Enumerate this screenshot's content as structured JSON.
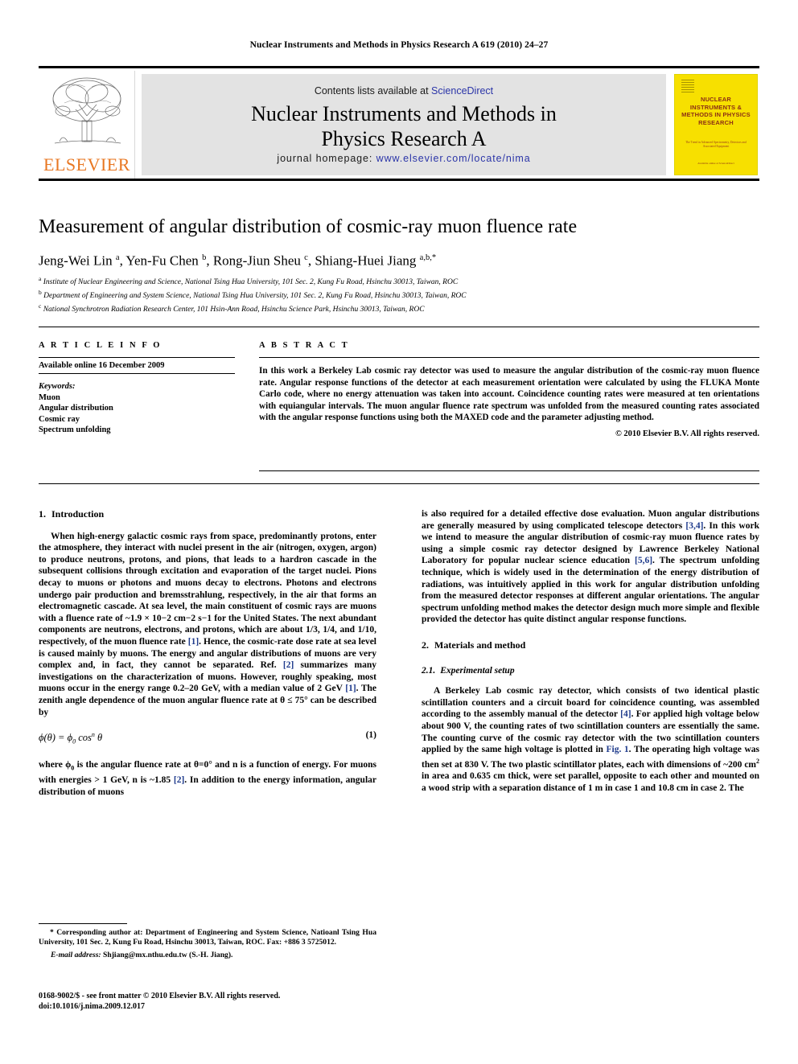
{
  "running_head": "Nuclear Instruments and Methods in Physics Research A 619 (2010) 24–27",
  "masthead": {
    "publisher_wordmark": "ELSEVIER",
    "contents_prefix": "Contents lists available at ",
    "contents_link": "ScienceDirect",
    "journal_title_line1": "Nuclear Instruments and Methods in",
    "journal_title_line2": "Physics Research A",
    "homepage_prefix": "journal homepage: ",
    "homepage_url": "www.elsevier.com/locate/nima",
    "cover": {
      "title": "NUCLEAR INSTRUMENTS & METHODS IN PHYSICS RESEARCH",
      "subtitle": "The Trend in Advanced Spectrometry, Detectors and Associated Equipment",
      "footer": "Available online at ScienceDirect"
    },
    "accent_orange": "#E87722",
    "link_blue": "#2b35a8",
    "cover_yellow": "#f7e000"
  },
  "article": {
    "title": "Measurement of angular distribution of cosmic-ray muon fluence rate",
    "authors": "Jeng-Wei Lin a, Yen-Fu Chen b, Rong-Jiun Sheu c, Shiang-Huei Jiang a,b,*",
    "affiliations": [
      "a Institute of Nuclear Engineering and Science, National Tsing Hua University, 101 Sec. 2, Kung Fu Road, Hsinchu 30013, Taiwan, ROC",
      "b Department of Engineering and System Science, National Tsing Hua University, 101 Sec. 2, Kung Fu Road, Hsinchu 30013, Taiwan, ROC",
      "c National Synchrotron Radiation Research Center, 101 Hsin-Ann Road, Hsinchu Science Park, Hsinchu 30013, Taiwan, ROC"
    ]
  },
  "article_info": {
    "heading": "A R T I C L E   I N F O",
    "available_online": "Available online 16 December 2009",
    "keywords_label": "Keywords:",
    "keywords": [
      "Muon",
      "Angular distribution",
      "Cosmic ray",
      "Spectrum unfolding"
    ]
  },
  "abstract": {
    "heading": "A B S T R A C T",
    "text": "In this work a Berkeley Lab cosmic ray detector was used to measure the angular distribution of the cosmic-ray muon fluence rate. Angular response functions of the detector at each measurement orientation were calculated by using the FLUKA Monte Carlo code, where no energy attenuation was taken into account. Coincidence counting rates were measured at ten orientations with equiangular intervals. The muon angular fluence rate spectrum was unfolded from the measured counting rates associated with the angular response functions using both the MAXED code and the parameter adjusting method.",
    "copyright": "© 2010 Elsevier B.V. All rights reserved."
  },
  "body": {
    "section1_num": "1.",
    "section1_title": "Introduction",
    "section2_num": "2.",
    "section2_title": "Materials and method",
    "section21_num": "2.1.",
    "section21_title": "Experimental setup",
    "left_p1_a": "When high-energy galactic cosmic rays from space, predominantly protons, enter the atmosphere, they interact with nuclei present in the air (nitrogen, oxygen, argon) to produce neutrons, protons, and pions, that leads to a hardron cascade in the subsequent collisions through excitation and evaporation of the target nuclei. Pions decay to muons or photons and muons decay to electrons. Photons and electrons undergo pair production and bremsstrahlung, respectively, in the air that forms an electromagnetic cascade. At sea level, the main constituent of cosmic rays are muons with a fluence rate of ",
    "left_p1_rate": "~1.9 × 10−2 cm−2 s−1",
    "left_p1_b": " for the United States. The next abundant components are neutrons, electrons, and protons, which are about 1/3, 1/4, and 1/10, respectively, of the muon fluence rate ",
    "cite1": "[1]",
    "left_p1_c": ". Hence, the cosmic-rate dose rate at sea level is caused mainly by muons. The energy and angular distributions of muons are very complex and, in fact, they cannot be separated. Ref. ",
    "cite2": "[2]",
    "left_p1_d": " summarizes many investigations on the characterization of muons. However, roughly speaking, most muons occur in the energy range 0.2–20 GeV, with a median value of 2 GeV ",
    "cite1b": "[1]",
    "left_p1_e": ". The zenith angle dependence of the muon angular fluence rate at θ ≤ 75° can be described by",
    "equation": "ϕ(θ) = ϕ0 cosn θ",
    "equation_number": "(1)",
    "left_p2_a": "where ϕ0 is the angular fluence rate at θ=0° and n is a function of energy. For muons with energies > 1 GeV, n is ~1.85 ",
    "cite2b": "[2]",
    "left_p2_b": ". In addition to the energy information, angular distribution of muons",
    "right_p1_a": "is also required for a detailed effective dose evaluation. Muon angular distributions are generally measured by using complicated telescope detectors ",
    "cite34": "[3,4]",
    "right_p1_b": ". In this work we intend to measure the angular distribution of cosmic-ray muon fluence rates by using a simple cosmic ray detector designed by Lawrence Berkeley National Laboratory for popular nuclear science education ",
    "cite56": "[5,6]",
    "right_p1_c": ". The spectrum unfolding technique, which is widely used in the determination of the energy distribution of radiations, was intuitively applied in this work for angular distribution unfolding from the measured detector responses at different angular orientations. The angular spectrum unfolding method makes the detector design much more simple and flexible provided the detector has quite distinct angular response functions.",
    "right_p2_a": "A Berkeley Lab cosmic ray detector, which consists of two identical plastic scintillation counters and a circuit board for coincidence counting, was assembled according to the assembly manual of the detector ",
    "cite4": "[4]",
    "right_p2_b": ". For applied high voltage below about 900 V, the counting rates of two scintillation counters are essentially the same. The counting curve of the cosmic ray detector with the two scintillation counters applied by the same high voltage is plotted in ",
    "figref": "Fig. 1",
    "right_p2_c": ". The operating high voltage was then set at 830 V. The two plastic scintillator plates, each with dimensions of ~200 cm2 in area and 0.635 cm thick, were set parallel, opposite to each other and mounted on a wood strip with a separation distance of 1 m in case 1 and 10.8 cm in case 2. The"
  },
  "footnote": {
    "star": "*",
    "corresponding": " Corresponding author at: Department of Engineering and System Science, Natioanl Tsing Hua University, 101 Sec. 2, Kung Fu Road, Hsinchu 30013, Taiwan, ROC. Fax: +886 3 5725012.",
    "email_label": "E-mail address:",
    "email": " Shjiang@mx.nthu.edu.tw (S.-H. Jiang).",
    "issn_line": "0168-9002/$ - see front matter © 2010 Elsevier B.V. All rights reserved.",
    "doi_line": "doi:10.1016/j.nima.2009.12.017"
  }
}
